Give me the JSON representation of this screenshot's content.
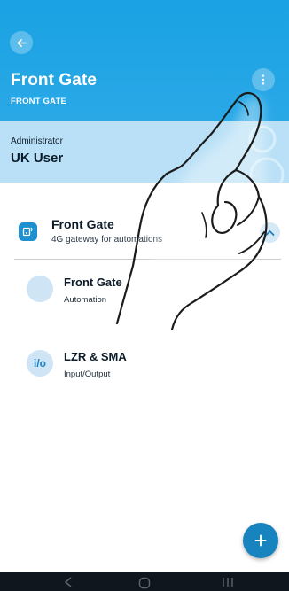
{
  "header": {
    "title": "Front Gate",
    "subtitle": "FRONT GATE",
    "back_icon": "arrow-left-icon",
    "menu_icon": "more-vertical-icon",
    "background_color": "#19a2e4"
  },
  "user": {
    "role": "Administrator",
    "name": "UK User",
    "background_color": "#b9e0f6"
  },
  "device_group": {
    "name": "Front Gate",
    "description": "4G gateway for automations",
    "icon": "gateway-icon",
    "collapse_icon": "chevron-up-icon",
    "items": [
      {
        "name": "Front Gate",
        "type": "Automation",
        "icon_text": ""
      },
      {
        "name": "LZR & SMA",
        "type": "Input/Output",
        "icon_text": "i/o"
      }
    ]
  },
  "fab": {
    "icon": "plus-icon",
    "color": "#1783bf"
  },
  "system_nav": {
    "icons": [
      "back-nav-icon",
      "home-nav-icon",
      "recents-nav-icon"
    ]
  }
}
